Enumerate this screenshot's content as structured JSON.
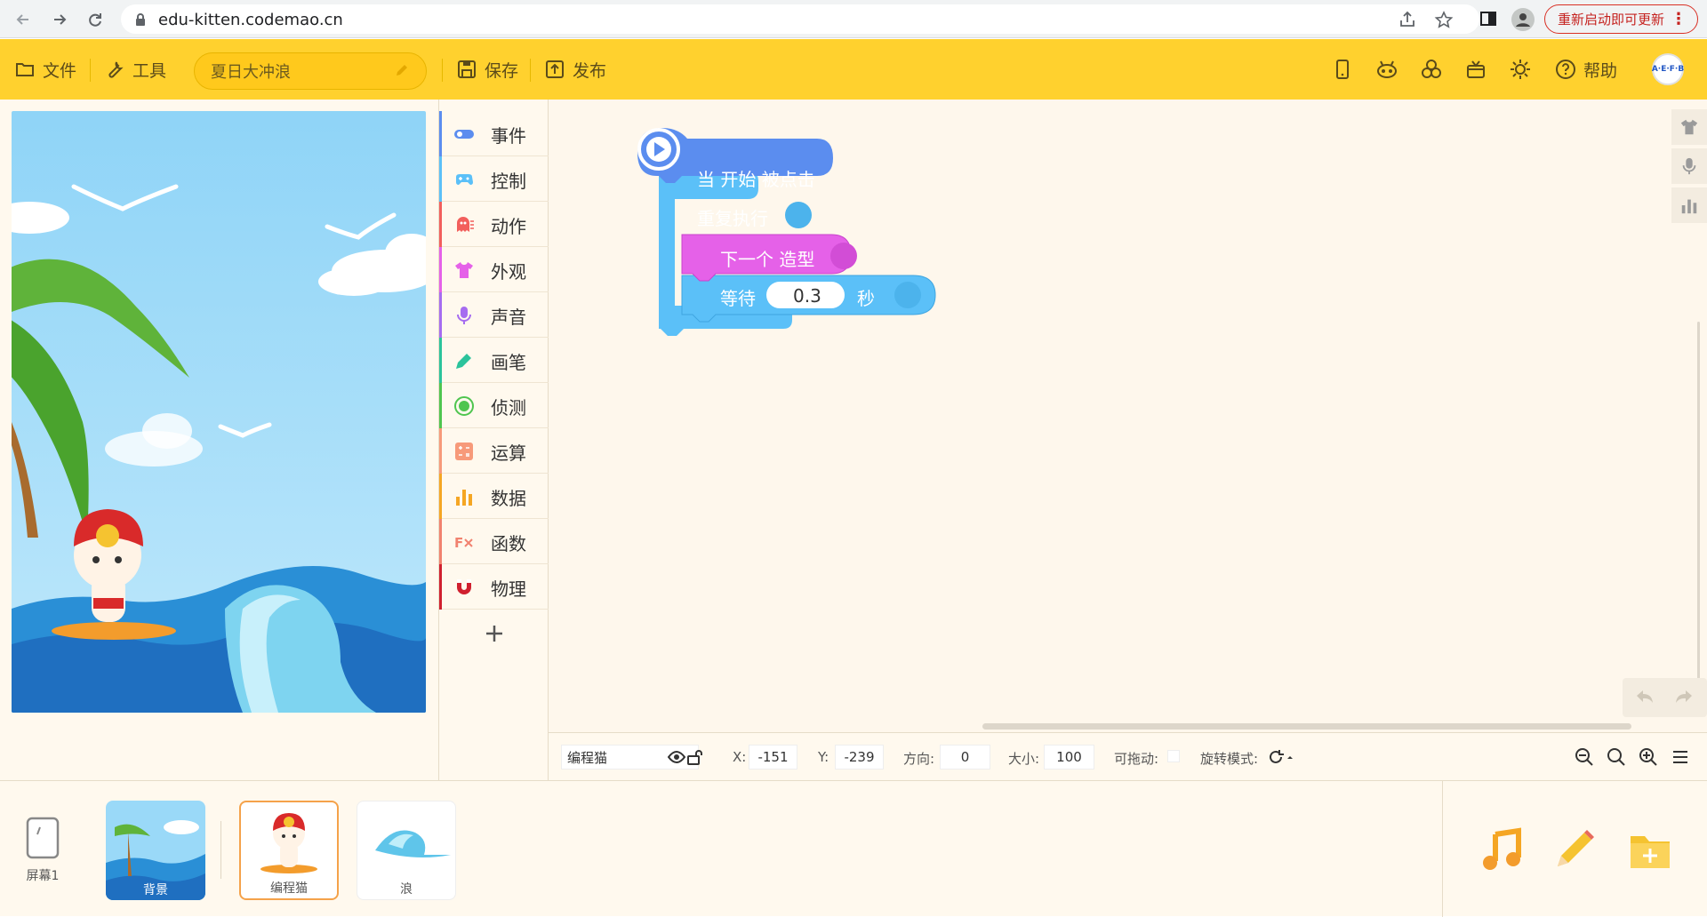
{
  "browser": {
    "url": "edu-kitten.codemao.cn",
    "restart_label": "重新启动即可更新"
  },
  "toolbar": {
    "file_label": "文件",
    "tools_label": "工具",
    "project_name": "夏日大冲浪",
    "save_label": "保存",
    "publish_label": "发布",
    "help_label": "帮助",
    "avatar_text": "A·E·F·B"
  },
  "categories": [
    {
      "label": "事件",
      "color": "#5b8def"
    },
    {
      "label": "控制",
      "color": "#5bc0f8"
    },
    {
      "label": "动作",
      "color": "#f25f5c"
    },
    {
      "label": "外观",
      "color": "#e561e8"
    },
    {
      "label": "声音",
      "color": "#a66cf0"
    },
    {
      "label": "画笔",
      "color": "#2bc39b"
    },
    {
      "label": "侦测",
      "color": "#4fc54f"
    },
    {
      "label": "运算",
      "color": "#f79a7a"
    },
    {
      "label": "数据",
      "color": "#f5a623"
    },
    {
      "label": "函数",
      "color": "#f1826f"
    },
    {
      "label": "物理",
      "color": "#d0202f"
    }
  ],
  "blocks": {
    "hat_label": "当 开始 被点击",
    "repeat_label": "重复执行",
    "next_costume_label": "下一个 造型",
    "wait_label": "等待",
    "wait_value": "0.3",
    "wait_unit": "秒"
  },
  "properties": {
    "sprite_name": "编程猫",
    "x_label": "X:",
    "x_value": "-151",
    "y_label": "Y:",
    "y_value": "-239",
    "direction_label": "方向:",
    "direction_value": "0",
    "size_label": "大小:",
    "size_value": "100",
    "draggable_label": "可拖动:",
    "rotation_label": "旋转模式:"
  },
  "bottom": {
    "screen_label": "屏幕1",
    "sprites": [
      {
        "name": "背景",
        "selected": false
      },
      {
        "name": "编程猫",
        "selected": true
      },
      {
        "name": "浪",
        "selected": false
      }
    ]
  }
}
